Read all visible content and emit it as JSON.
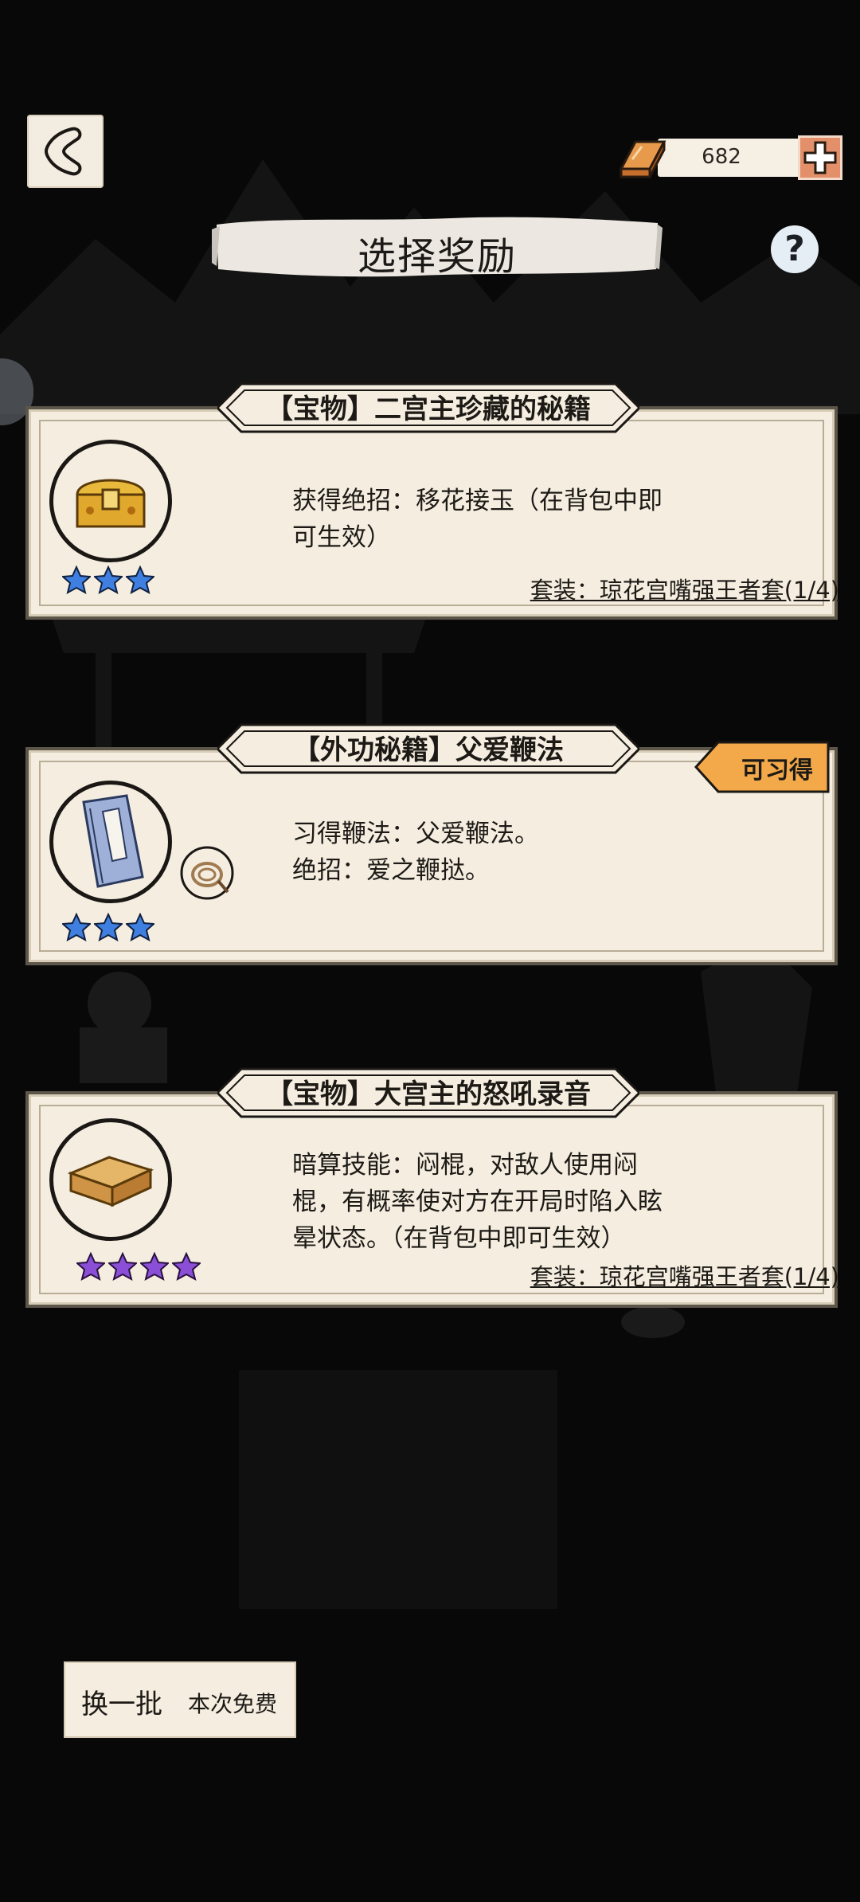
{
  "screen": {
    "title": "选择奖励",
    "help_icon": "question-mark-icon",
    "back_icon": "back-arrow-icon"
  },
  "currency": {
    "icon": "gold-ingot-icon",
    "amount": "682",
    "add_icon": "plus-icon"
  },
  "rewards": [
    {
      "banner": "【宝物】二宫主珍藏的秘籍",
      "icon": "treasure-chest-icon",
      "stars": 3,
      "star_color": "#3f7fe0",
      "desc_line1": "获得绝招：移花接玉（在背包中即",
      "desc_line2": "可生效）",
      "set": "套装：琼花宫嘴强王者套(1/4)"
    },
    {
      "banner": "【外功秘籍】父爱鞭法",
      "icon": "martial-arts-book-icon",
      "sub_icon": "whip-icon",
      "stars": 3,
      "star_color": "#3f7fe0",
      "tag": "可习得",
      "desc_line1": "习得鞭法：父爱鞭法。",
      "desc_line2": "绝招：爱之鞭挞。"
    },
    {
      "banner": "【宝物】大宫主的怒吼录音",
      "icon": "wooden-box-icon",
      "stars": 4,
      "star_color": "#8a4fd6",
      "desc_line1": "暗算技能：闷棍，对敌人使用闷",
      "desc_line2": "棍，有概率使对方在开局时陷入眩",
      "desc_line3": "晕状态。（在背包中即可生效）",
      "set": "套装：琼花宫嘴强王者套(1/4)"
    }
  ],
  "refresh": {
    "label": "换一批",
    "cost_note": "本次免费"
  },
  "colors": {
    "background": "#080808",
    "card": "#f4ede0",
    "tag": "#f3a94a",
    "plus_button": "#e28f6a"
  }
}
